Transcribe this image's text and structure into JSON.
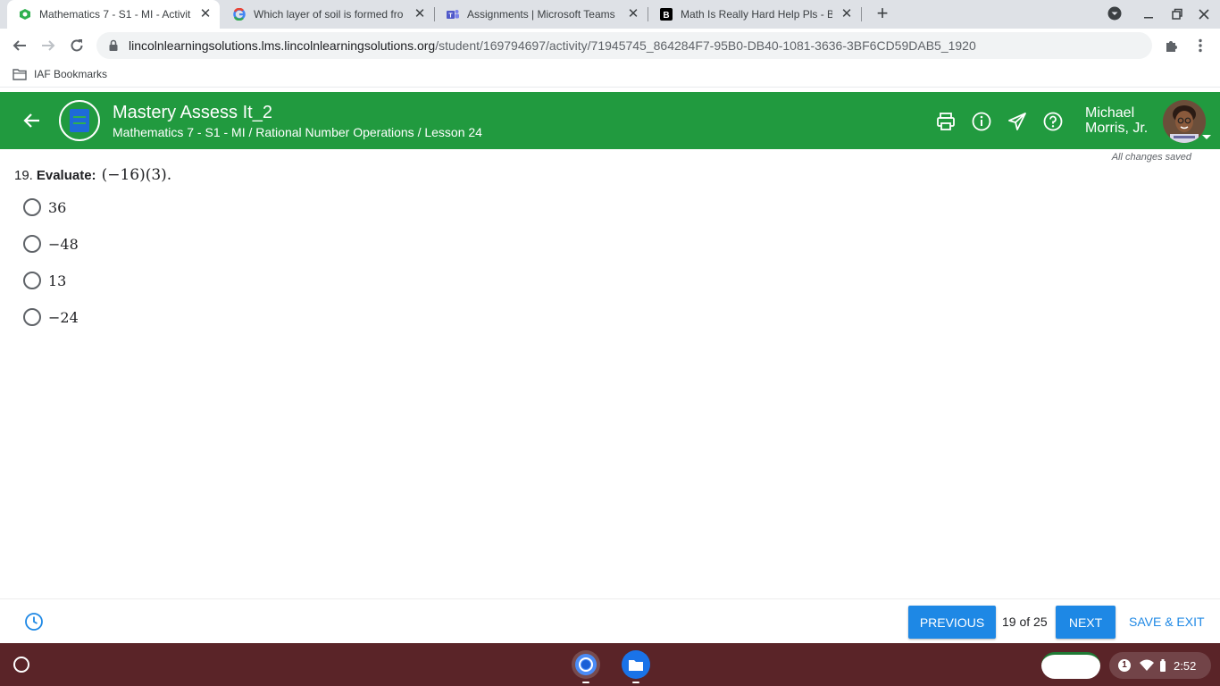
{
  "browser": {
    "tabs": [
      {
        "title": "Mathematics 7 - S1 - MI - Activiti",
        "active": true,
        "favicon": "lincoln-learning-icon"
      },
      {
        "title": "Which layer of soil is formed fro",
        "active": false,
        "favicon": "google-icon"
      },
      {
        "title": "Assignments | Microsoft Teams",
        "active": false,
        "favicon": "teams-icon"
      },
      {
        "title": "Math Is Really Hard Help Pls - Br",
        "active": false,
        "favicon": "brainly-icon"
      }
    ],
    "url_host": "lincolnlearningsolutions.lms.lincolnlearningsolutions.org",
    "url_path": "/student/169794697/activity/71945745_864284F7-95B0-DB40-1081-3636-3BF6CD59DAB5_1920",
    "bookmark": "IAF Bookmarks"
  },
  "app": {
    "title": "Mastery Assess It_2",
    "breadcrumb": "Mathematics 7 - S1 - MI / Rational Number Operations / Lesson 24",
    "user_first": "Michael",
    "user_last": "Morris, Jr.",
    "save_status": "All changes saved",
    "accent": "#219a3f",
    "button_color": "#1e88e5"
  },
  "question": {
    "number": "19.",
    "label": "Evaluate:",
    "expression": "(−16)(3).",
    "options": [
      "36",
      "−48",
      "13",
      "−24"
    ]
  },
  "footer": {
    "previous": "PREVIOUS",
    "page": "19 of 25",
    "next": "NEXT",
    "save_exit": "SAVE & EXIT"
  },
  "shelf": {
    "notification_count": "1",
    "time": "2:52"
  }
}
